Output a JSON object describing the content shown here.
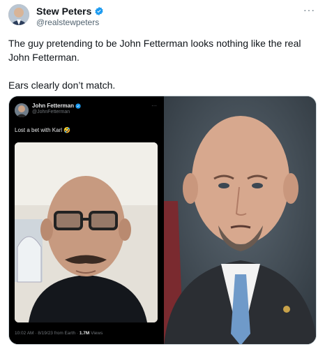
{
  "tweet": {
    "author_name": "Stew Peters",
    "author_handle": "@realstewpeters",
    "more_label": "···",
    "text_line1": "The guy pretending to be John Fetterman looks nothing like the real John Fetterman.",
    "text_line2": "Ears clearly don’t match."
  },
  "embedded_tweet": {
    "author_name": "John Fetterman",
    "author_handle": "@JohnFetterman",
    "more_label": "···",
    "text": "Lost a bet with Karl 🤣",
    "meta_time": "10:02 AM · 8/19/23 from Earth · ",
    "meta_views_count": "1.7M",
    "meta_views_label": " Views"
  },
  "colors": {
    "verified": "#1d9bf0",
    "text_primary": "#0f1419",
    "text_secondary": "#536471"
  },
  "icons": {
    "verified": "verified-badge-icon",
    "more": "more-options-icon"
  }
}
